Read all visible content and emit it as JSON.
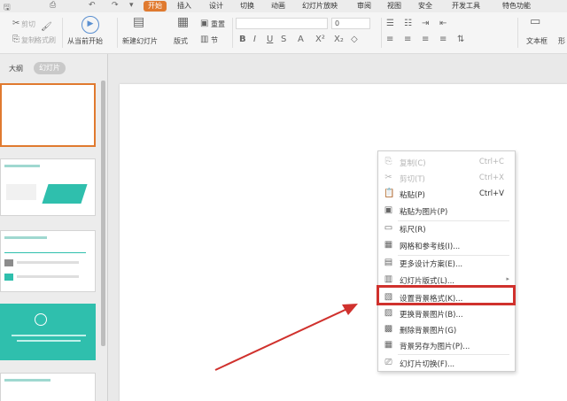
{
  "quick_access": [
    "🖫",
    "⎙",
    "↶",
    "↷",
    "▾"
  ],
  "tabs": [
    {
      "label": "开始",
      "active": true
    },
    {
      "label": "插入"
    },
    {
      "label": "设计"
    },
    {
      "label": "切换"
    },
    {
      "label": "动画"
    },
    {
      "label": "幻灯片放映"
    },
    {
      "label": "审阅"
    },
    {
      "label": "视图"
    },
    {
      "label": "安全"
    },
    {
      "label": "开发工具"
    },
    {
      "label": "特色功能"
    }
  ],
  "ribbon": {
    "cut": "剪切",
    "copy": "复制",
    "format_painter": "格式刷",
    "from_current": "从当前开始",
    "new_slide": "新建幻灯片",
    "layout": "版式",
    "section": "节",
    "reset": "重置",
    "font_size": "0",
    "text_box": "文本框",
    "shape_partial": "形"
  },
  "left_panel": {
    "outline_label": "大纲",
    "slides_label": "幻灯片"
  },
  "context_menu": {
    "items": [
      {
        "label": "复制(C)",
        "shortcut": "Ctrl+C",
        "disabled": true,
        "icon": "copy-icon",
        "glyph": "⎘"
      },
      {
        "label": "剪切(T)",
        "shortcut": "Ctrl+X",
        "disabled": true,
        "icon": "scissors-icon",
        "glyph": "✂"
      },
      {
        "label": "粘贴(P)",
        "shortcut": "Ctrl+V",
        "disabled": false,
        "icon": "paste-icon",
        "glyph": "📋"
      },
      {
        "label": "粘贴为图片(P)",
        "shortcut": "",
        "disabled": false,
        "icon": "paste-image-icon",
        "glyph": "▣"
      },
      {
        "label": "标尺(R)",
        "shortcut": "",
        "disabled": false,
        "icon": "ruler-icon",
        "glyph": "▭"
      },
      {
        "label": "网格和参考线(I)...",
        "shortcut": "",
        "disabled": false,
        "icon": "grid-icon",
        "glyph": "▦"
      },
      {
        "label": "更多设计方案(E)...",
        "shortcut": "",
        "disabled": false,
        "icon": "design-icon",
        "glyph": "▤"
      },
      {
        "label": "幻灯片版式(L)...",
        "shortcut": "",
        "disabled": false,
        "icon": "layout-icon",
        "glyph": "▥",
        "submenu": true
      },
      {
        "label": "设置背景格式(K)...",
        "shortcut": "",
        "disabled": false,
        "icon": "background-format-icon",
        "glyph": "▧"
      },
      {
        "label": "更换背景图片(B)...",
        "shortcut": "",
        "disabled": false,
        "icon": "change-background-icon",
        "glyph": "▨"
      },
      {
        "label": "删除背景图片(G)",
        "shortcut": "",
        "disabled": false,
        "icon": "delete-background-icon",
        "glyph": "▩"
      },
      {
        "label": "背景另存为图片(P)...",
        "shortcut": "",
        "disabled": false,
        "icon": "save-background-icon",
        "glyph": "▦"
      },
      {
        "label": "幻灯片切换(F)...",
        "shortcut": "",
        "disabled": false,
        "icon": "transition-icon",
        "glyph": "⎚"
      }
    ]
  },
  "colors": {
    "accent": "#e07a2f",
    "highlight": "#d0312d",
    "teal": "#2fbfad"
  }
}
